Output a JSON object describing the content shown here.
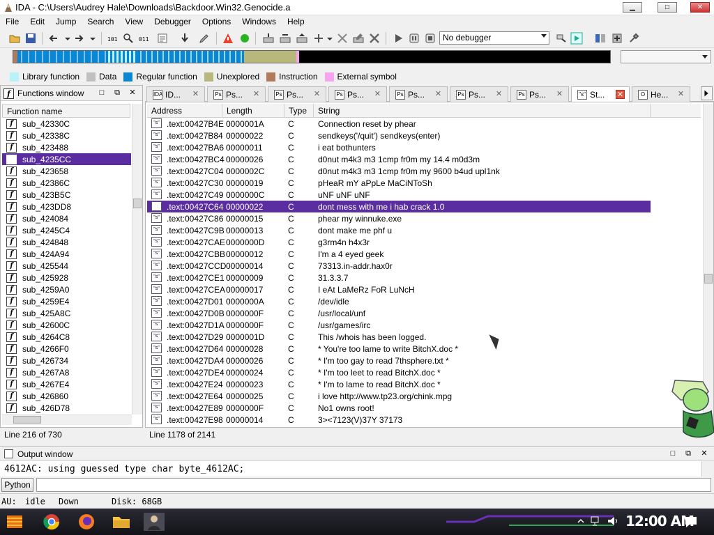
{
  "window": {
    "title": "IDA - C:\\Users\\Audrey Hale\\Downloads\\Backdoor.Win32.Genocide.a",
    "minimize_label": "▁",
    "maximize_label": "□",
    "close_label": "✕"
  },
  "menu": [
    "File",
    "Edit",
    "Jump",
    "Search",
    "View",
    "Debugger",
    "Options",
    "Windows",
    "Help"
  ],
  "toolbar": {
    "debugger_select": "No debugger"
  },
  "legend": [
    {
      "label": "Library function",
      "color": "#b7f3f7"
    },
    {
      "label": "Data",
      "color": "#c0c0c0"
    },
    {
      "label": "Regular function",
      "color": "#0a87d4"
    },
    {
      "label": "Unexplored",
      "color": "#b8b77c"
    },
    {
      "label": "Instruction",
      "color": "#b07a5b"
    },
    {
      "label": "External symbol",
      "color": "#f5a4f0"
    }
  ],
  "colors": {
    "selection": "#5a2ea0",
    "tab_close_active": "#e35a3b"
  },
  "functions_window": {
    "title": "Functions window",
    "column": "Function name",
    "status": "Line 216 of 730",
    "icon_glyph": "f",
    "items": [
      "sub_42330C",
      "sub_42338C",
      "sub_423488",
      "sub_4235CC",
      "sub_423658",
      "sub_42386C",
      "sub_423B5C",
      "sub_423DD8",
      "sub_424084",
      "sub_4245C4",
      "sub_424848",
      "sub_424A94",
      "sub_425544",
      "sub_425928",
      "sub_4259A0",
      "sub_4259E4",
      "sub_425A8C",
      "sub_42600C",
      "sub_4264C8",
      "sub_4266F0",
      "sub_426734",
      "sub_4267A8",
      "sub_4267E4",
      "sub_426860",
      "sub_426D78"
    ],
    "selected_index": 3
  },
  "tabs": [
    {
      "label": "ID...",
      "icon": "IDA",
      "active": false
    },
    {
      "label": "Ps...",
      "icon": "Ps",
      "active": false
    },
    {
      "label": "Ps...",
      "icon": "Ps",
      "active": false
    },
    {
      "label": "Ps...",
      "icon": "Ps",
      "active": false
    },
    {
      "label": "Ps...",
      "icon": "Ps",
      "active": false
    },
    {
      "label": "Ps...",
      "icon": "Ps",
      "active": false
    },
    {
      "label": "Ps...",
      "icon": "Ps",
      "active": false
    },
    {
      "label": "St...",
      "icon": "\"s\"",
      "active": true
    },
    {
      "label": "He...",
      "icon": "O",
      "active": false
    }
  ],
  "strings_window": {
    "columns": [
      "Address",
      "Length",
      "Type",
      "String"
    ],
    "status": "Line 1178 of 2141",
    "icon_glyph": "\"s\"",
    "selected_index": 7,
    "rows": [
      {
        "address": ".text:00427B4E",
        "length": "0000001A",
        "type": "C",
        "string": "Connection reset by phear"
      },
      {
        "address": ".text:00427B84",
        "length": "00000022",
        "type": "C",
        "string": "sendkeys('/quit') sendkeys(enter)"
      },
      {
        "address": ".text:00427BA6",
        "length": "00000011",
        "type": "C",
        "string": "i eat bothunters"
      },
      {
        "address": ".text:00427BC4",
        "length": "00000026",
        "type": "C",
        "string": "d0nut m4k3 m3 1cmp fr0m my 14.4 m0d3m"
      },
      {
        "address": ".text:00427C04",
        "length": "0000002C",
        "type": "C",
        "string": "d0nut m4k3 m3 1cmp fr0m my 9600 b4ud upl1nk"
      },
      {
        "address": ".text:00427C30",
        "length": "00000019",
        "type": "C",
        "string": "pHeaR mY aPpLe MaCiNToSh"
      },
      {
        "address": ".text:00427C49",
        "length": "0000000C",
        "type": "C",
        "string": "uNF uNF uNF"
      },
      {
        "address": ".text:00427C64",
        "length": "00000022",
        "type": "C",
        "string": "dont mess with me i hab crack 1.0"
      },
      {
        "address": ".text:00427C86",
        "length": "00000015",
        "type": "C",
        "string": "phear my winnuke.exe"
      },
      {
        "address": ".text:00427C9B",
        "length": "00000013",
        "type": "C",
        "string": "dont make me phf u"
      },
      {
        "address": ".text:00427CAE",
        "length": "0000000D",
        "type": "C",
        "string": "g3rm4n h4x3r"
      },
      {
        "address": ".text:00427CBB",
        "length": "00000012",
        "type": "C",
        "string": "I'm a 4 eyed geek"
      },
      {
        "address": ".text:00427CCD",
        "length": "00000014",
        "type": "C",
        "string": "73313.in-addr.hax0r"
      },
      {
        "address": ".text:00427CE1",
        "length": "00000009",
        "type": "C",
        "string": "31.3.3.7"
      },
      {
        "address": ".text:00427CEA",
        "length": "00000017",
        "type": "C",
        "string": "I eAt LaMeRz FoR LuNcH"
      },
      {
        "address": ".text:00427D01",
        "length": "0000000A",
        "type": "C",
        "string": "/dev/idle"
      },
      {
        "address": ".text:00427D0B",
        "length": "0000000F",
        "type": "C",
        "string": "/usr/local/unf"
      },
      {
        "address": ".text:00427D1A",
        "length": "0000000F",
        "type": "C",
        "string": "/usr/games/irc"
      },
      {
        "address": ".text:00427D29",
        "length": "0000001D",
        "type": "C",
        "string": "This /whois has been logged."
      },
      {
        "address": ".text:00427D64",
        "length": "00000028",
        "type": "C",
        "string": "* You're too lame to write BitchX.doc *"
      },
      {
        "address": ".text:00427DA4",
        "length": "00000026",
        "type": "C",
        "string": "* I'm too gay to read 7thsphere.txt *"
      },
      {
        "address": ".text:00427DE4",
        "length": "00000024",
        "type": "C",
        "string": "* I'm too leet to read BitchX.doc *"
      },
      {
        "address": ".text:00427E24",
        "length": "00000023",
        "type": "C",
        "string": "* I'm to lame to read BitchX.doc *"
      },
      {
        "address": ".text:00427E64",
        "length": "00000025",
        "type": "C",
        "string": "i love http://www.tp23.org/chink.mpg"
      },
      {
        "address": ".text:00427E89",
        "length": "0000000F",
        "type": "C",
        "string": "No1 owns root!"
      },
      {
        "address": ".text:00427E98",
        "length": "00000014",
        "type": "C",
        "string": "3><7123(V)37Y 37173"
      }
    ]
  },
  "output_window": {
    "title": "Output window",
    "text": "4612AC: using guessed type char byte_4612AC;",
    "python_button": "Python"
  },
  "ida_status": {
    "au_label": "AU:",
    "au_state": "idle",
    "direction": "Down",
    "disk": "Disk: 68GB"
  },
  "taskbar": {
    "clock": "12:00 AM"
  }
}
